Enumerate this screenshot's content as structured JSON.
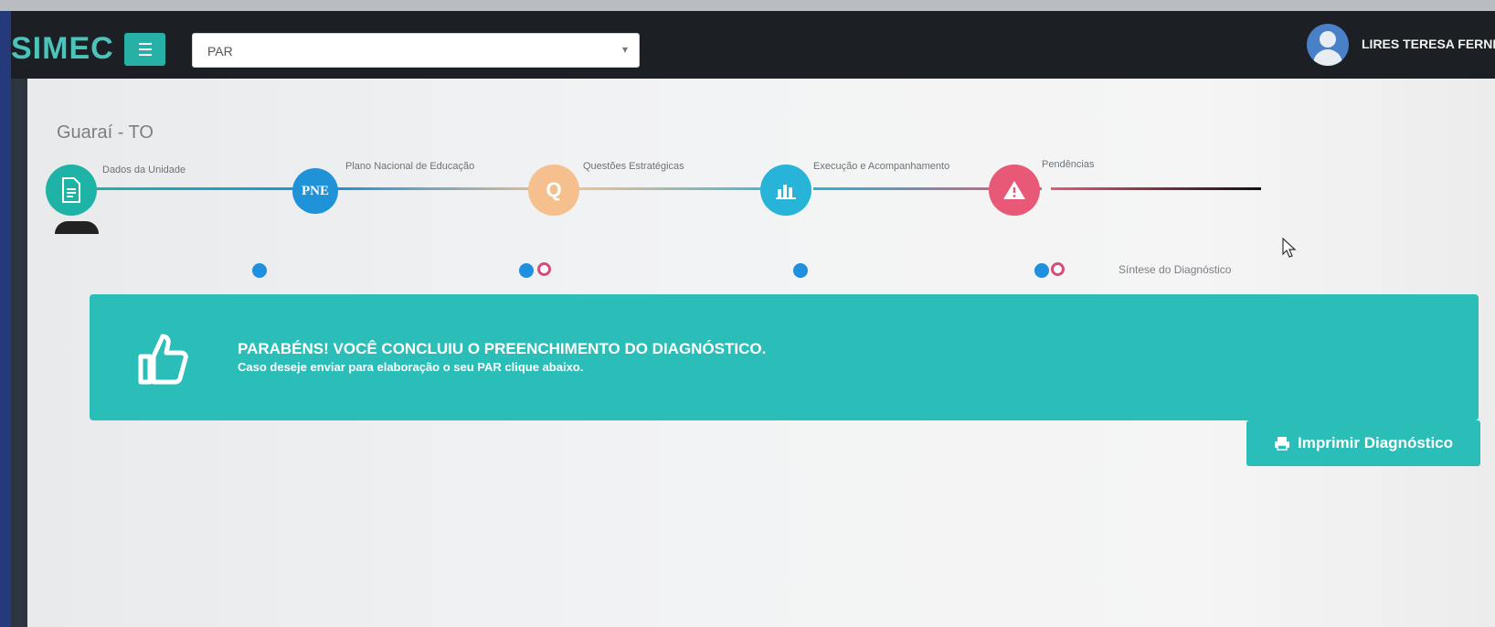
{
  "header": {
    "logo": "SIMEC",
    "module_select": {
      "value": "PAR"
    },
    "user_name": "LIRES TERESA FERNEDA"
  },
  "page": {
    "title": "Guaraí - TO"
  },
  "steps": [
    {
      "label": "Dados da Unidade",
      "icon": "document-icon",
      "color": "#1fb3a8"
    },
    {
      "label": "Plano Nacional de Educação",
      "icon_text": "PNE",
      "color": "#1f92d8"
    },
    {
      "label": "Questões Estratégicas",
      "icon_text": "Q",
      "color": "#f5c08e"
    },
    {
      "label": "Execução e Acompanhamento",
      "icon": "bar-chart-icon",
      "color": "#27b4d8"
    },
    {
      "label": "Pendências",
      "icon": "warning-icon",
      "color": "#e85877"
    }
  ],
  "substeps": {
    "summary_label": "Síntese do Diagnóstico"
  },
  "alert": {
    "title": "PARABÉNS! VOCÊ CONCLUIU O PREENCHIMENTO DO DIAGNÓSTICO.",
    "subtitle": "Caso deseje enviar para elaboração o seu PAR clique abaixo.",
    "icon": "thumbs-up-icon"
  },
  "actions": {
    "print_label": "Imprimir Diagnóstico"
  },
  "colors": {
    "accent": "#2bbdb8",
    "nav": "#1c2025",
    "blue": "#1f8fdf",
    "pink": "#d64d7a"
  }
}
